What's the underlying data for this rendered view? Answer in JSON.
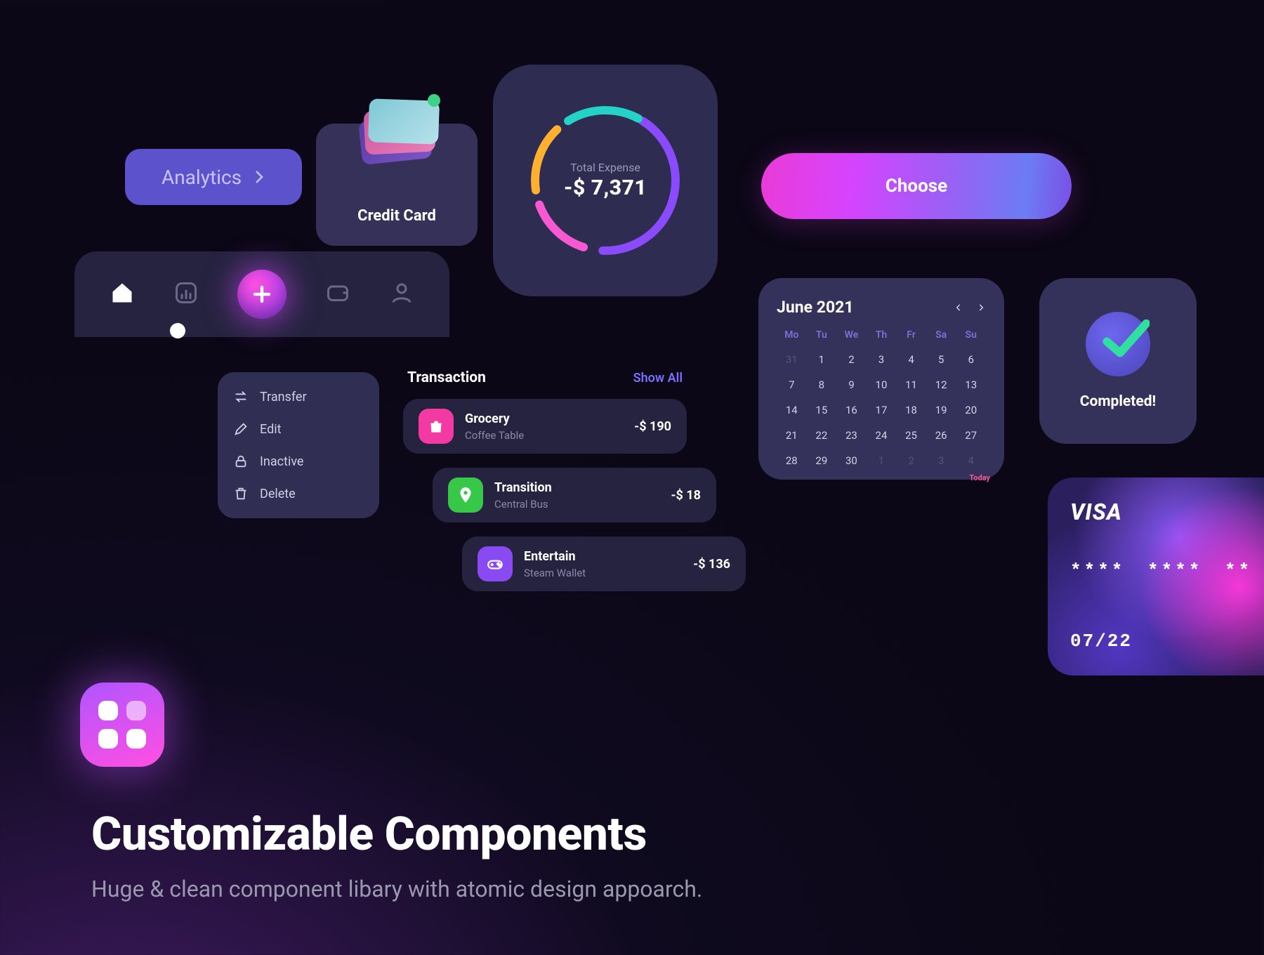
{
  "analytics_label": "Analytics",
  "creditcard_label": "Credit Card",
  "expense": {
    "label": "Total Expense",
    "value": "-$ 7,371"
  },
  "choose_label": "Choose",
  "context_menu": {
    "transfer": "Transfer",
    "edit": "Edit",
    "inactive": "Inactive",
    "delete": "Delete"
  },
  "transactions": {
    "title": "Transaction",
    "show_all": "Show All",
    "items": [
      {
        "name": "Grocery",
        "sub": "Coffee Table",
        "amount": "-$ 190"
      },
      {
        "name": "Transition",
        "sub": "Central Bus",
        "amount": "-$ 18"
      },
      {
        "name": "Entertain",
        "sub": "Steam Wallet",
        "amount": "-$ 136"
      }
    ]
  },
  "calendar": {
    "month": "June 2021",
    "today_label": "Today",
    "dow": [
      "Mo",
      "Tu",
      "We",
      "Th",
      "Fr",
      "Sa",
      "Su"
    ],
    "days": [
      [
        "31",
        "1",
        "2",
        "3",
        "4",
        "5",
        "6"
      ],
      [
        "7",
        "8",
        "9",
        "10",
        "11",
        "12",
        "13"
      ],
      [
        "14",
        "15",
        "16",
        "17",
        "18",
        "19",
        "20"
      ],
      [
        "21",
        "22",
        "23",
        "24",
        "25",
        "26",
        "27"
      ],
      [
        "28",
        "29",
        "30",
        "1",
        "2",
        "3",
        "4"
      ]
    ],
    "muted_cells": [
      [
        0,
        0
      ],
      [
        4,
        3
      ],
      [
        4,
        4
      ],
      [
        4,
        5
      ],
      [
        4,
        6
      ]
    ]
  },
  "completed_label": "Completed!",
  "visa": {
    "brand": "VISA",
    "pan": "**** **** **",
    "exp": "07/22"
  },
  "headline": {
    "title": "Customizable Components",
    "sub": "Huge & clean component libary with atomic design appoarch."
  }
}
